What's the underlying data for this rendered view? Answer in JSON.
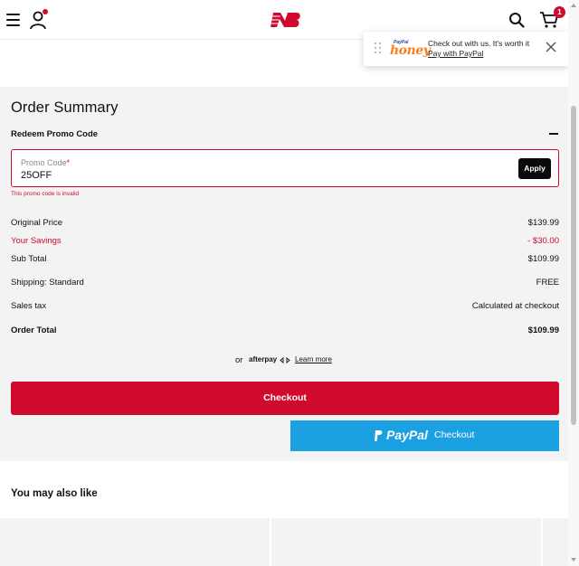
{
  "header": {
    "cart_count": "1",
    "brand_color": "#cf0a2c"
  },
  "honey_popup": {
    "logo_small": "PayPal",
    "logo_brand": "honey",
    "message": "Check out with us. It's worth it",
    "link": "Pay with PayPal"
  },
  "summary": {
    "title": "Order Summary",
    "redeem_label": "Redeem Promo Code",
    "promo": {
      "label": "Promo Code",
      "required_mark": "*",
      "value": "25OFF",
      "apply_label": "Apply",
      "error": "This promo code is invalid"
    },
    "rows": {
      "original_label": "Original Price",
      "original_value": "$139.99",
      "savings_label": "Your Savings",
      "savings_value": "- $30.00",
      "subtotal_label": "Sub Total",
      "subtotal_value": "$109.99",
      "shipping_label": "Shipping: Standard",
      "shipping_value": "FREE",
      "tax_label": "Sales tax",
      "tax_value": "Calculated at checkout",
      "total_label": "Order Total",
      "total_value": "$109.99"
    },
    "afterpay": {
      "or": "or",
      "brand": "afterpay",
      "learn_more": "Learn more"
    },
    "checkout_label": "Checkout",
    "paypal": {
      "brand": "PayPal",
      "label": "Checkout",
      "color": "#1ba0e2"
    }
  },
  "recommendations": {
    "title": "You may also like"
  }
}
